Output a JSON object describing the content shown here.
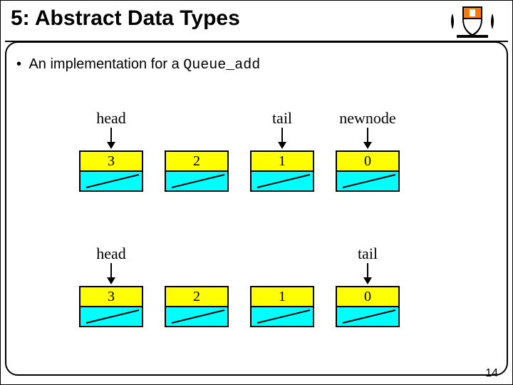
{
  "title": "5: Abstract Data Types",
  "bullet_prefix": "An implementation for a ",
  "bullet_code": "Queue_add",
  "page_number": "14",
  "labels": {
    "head": "head",
    "tail": "tail",
    "newnode": "newnode"
  },
  "row1": {
    "pointers": [
      "head",
      "",
      "tail",
      "newnode"
    ],
    "values": [
      "3",
      "2",
      "1",
      "0"
    ]
  },
  "row2": {
    "pointers": [
      "head",
      "",
      "",
      "tail"
    ],
    "values": [
      "3",
      "2",
      "1",
      "0"
    ]
  }
}
